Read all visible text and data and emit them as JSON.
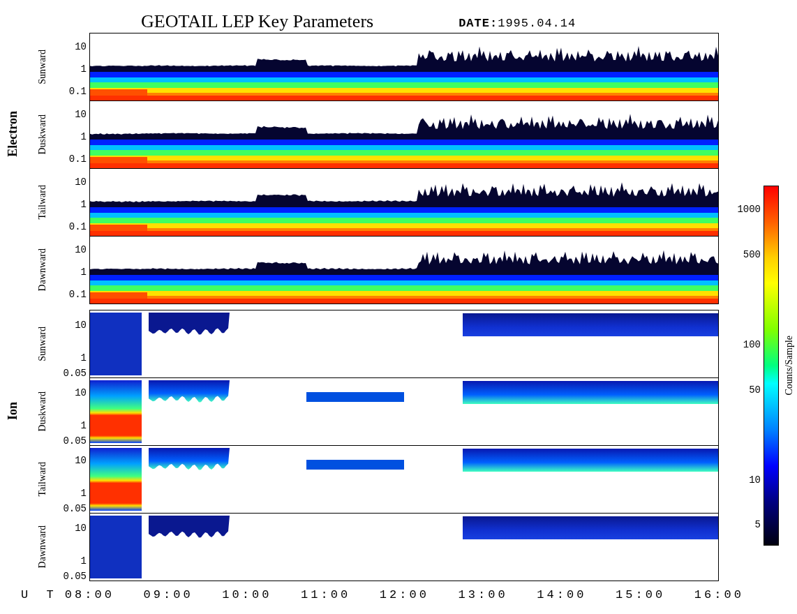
{
  "title": "GEOTAIL LEP Key Parameters",
  "date": "**DATE:**1995.04.14",
  "groups": [
    {
      "label": "Electron",
      "kind": "electron",
      "panels": [
        {
          "label": "Sunward",
          "yticks": [
            "10",
            "1",
            "0.1"
          ]
        },
        {
          "label": "Duskward",
          "yticks": [
            "10",
            "1",
            "0.1"
          ]
        },
        {
          "label": "Tailward",
          "yticks": [
            "10",
            "1",
            "0.1"
          ]
        },
        {
          "label": "Dawnward",
          "yticks": [
            "10",
            "1",
            "0.1"
          ]
        }
      ]
    },
    {
      "label": "Ion",
      "kind": "ion",
      "panels": [
        {
          "label": "Sunward",
          "yticks": [
            "10",
            "1",
            "0.05"
          ]
        },
        {
          "label": "Duskward",
          "yticks": [
            "10",
            "1",
            "0.05"
          ]
        },
        {
          "label": "Tailward",
          "yticks": [
            "10",
            "1",
            "0.05"
          ]
        },
        {
          "label": "Dawnward",
          "yticks": [
            "10",
            "1",
            "0.05"
          ]
        }
      ]
    }
  ],
  "x_axis": {
    "label": "U T",
    "ticks": [
      "08:00",
      "09:00",
      "10:00",
      "11:00",
      "12:00",
      "13:00",
      "14:00",
      "15:00",
      "16:00"
    ]
  },
  "colorbar": {
    "label": "Counts/Sample",
    "ticks": [
      "1000",
      "500",
      "100",
      "50",
      "10",
      "5"
    ]
  }
}
